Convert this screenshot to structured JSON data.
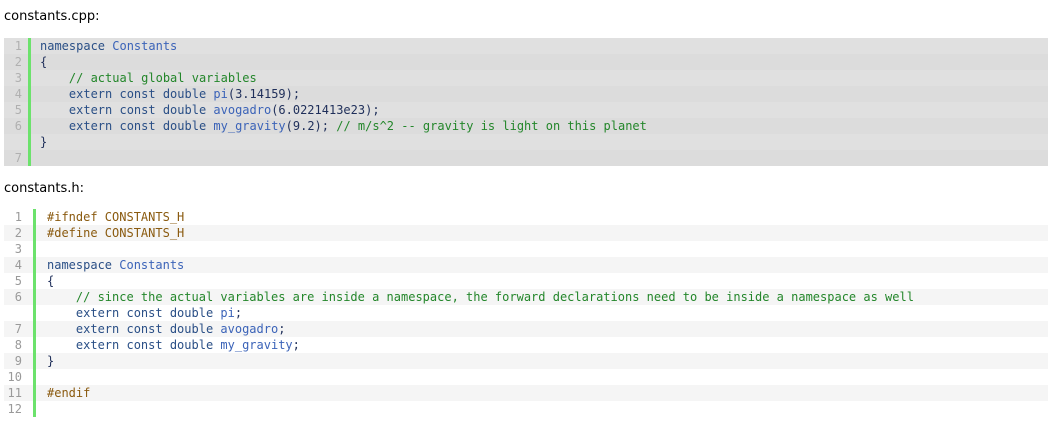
{
  "files": [
    {
      "name": "constants.cpp:",
      "lines": [
        {
          "n": "1",
          "segments": [
            {
              "t": "namespace ",
              "c": "kw"
            },
            {
              "t": "Constants",
              "c": "fn"
            }
          ]
        },
        {
          "n": "2",
          "segments": [
            {
              "t": "{",
              "c": "tx"
            }
          ]
        },
        {
          "n": "3",
          "segments": [
            {
              "t": "    // actual global variables",
              "c": "cm"
            }
          ]
        },
        {
          "n": "4",
          "segments": [
            {
              "t": "    extern const double ",
              "c": "kw"
            },
            {
              "t": "pi",
              "c": "fn"
            },
            {
              "t": "(3.14159);",
              "c": "tx"
            }
          ]
        },
        {
          "n": "5",
          "segments": [
            {
              "t": "    extern const double ",
              "c": "kw"
            },
            {
              "t": "avogadro",
              "c": "fn"
            },
            {
              "t": "(6.0221413e23);",
              "c": "tx"
            }
          ]
        },
        {
          "n": "6",
          "segments": [
            {
              "t": "    extern const double ",
              "c": "kw"
            },
            {
              "t": "my_gravity",
              "c": "fn"
            },
            {
              "t": "(9.2); ",
              "c": "tx"
            },
            {
              "t": "// m/s^2 -- gravity is light on this planet",
              "c": "cm"
            }
          ]
        },
        {
          "n": "",
          "segments": [
            {
              "t": "}",
              "c": "tx"
            }
          ]
        },
        {
          "n": "7",
          "segments": []
        }
      ]
    },
    {
      "name": "constants.h:",
      "lines": [
        {
          "n": "1",
          "segments": [
            {
              "t": "#ifndef CONSTANTS_H",
              "c": "pp"
            }
          ]
        },
        {
          "n": "2",
          "segments": [
            {
              "t": "#define CONSTANTS_H",
              "c": "pp"
            }
          ]
        },
        {
          "n": "3",
          "segments": []
        },
        {
          "n": "4",
          "segments": [
            {
              "t": "namespace ",
              "c": "kw"
            },
            {
              "t": "Constants",
              "c": "fn"
            }
          ]
        },
        {
          "n": "5",
          "segments": [
            {
              "t": "{",
              "c": "tx"
            }
          ]
        },
        {
          "n": "6",
          "segments": [
            {
              "t": "    // since the actual variables are inside a namespace, the forward declarations need to be inside a namespace as well",
              "c": "cm"
            }
          ]
        },
        {
          "n": "",
          "segments": [
            {
              "t": "    extern const double ",
              "c": "kw"
            },
            {
              "t": "pi",
              "c": "fn"
            },
            {
              "t": ";",
              "c": "tx"
            }
          ]
        },
        {
          "n": "7",
          "segments": [
            {
              "t": "    extern const double ",
              "c": "kw"
            },
            {
              "t": "avogadro",
              "c": "fn"
            },
            {
              "t": ";",
              "c": "tx"
            }
          ]
        },
        {
          "n": "8",
          "segments": [
            {
              "t": "    extern const double ",
              "c": "kw"
            },
            {
              "t": "my_gravity",
              "c": "fn"
            },
            {
              "t": ";",
              "c": "tx"
            }
          ]
        },
        {
          "n": "9",
          "segments": [
            {
              "t": "}",
              "c": "tx"
            }
          ]
        },
        {
          "n": "10",
          "segments": []
        },
        {
          "n": "11",
          "segments": [
            {
              "t": "#endif",
              "c": "pp"
            }
          ]
        },
        {
          "n": "12",
          "segments": []
        }
      ]
    }
  ],
  "colors": {
    "gutter_bar": "#6ce26c",
    "keyword": "#2a4f86",
    "comment": "#23862a",
    "preprocessor": "#8a5a0f"
  }
}
